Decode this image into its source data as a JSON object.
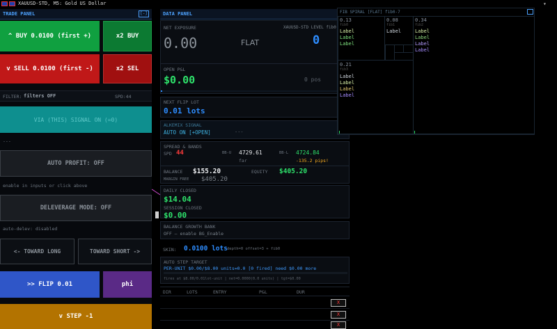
{
  "window": {
    "title": "XAUUSD-STD, M5:  Gold US Dollar"
  },
  "trade_panel": {
    "header": "TRADE PANEL",
    "header_btn": "[-]",
    "buy_label": "^ BUY  0.0100 (first +)",
    "x2_buy_label": "x2 BUY",
    "sell_label": "v SELL 0.0100 (first -)",
    "x2_sell_label": "x2 SEL",
    "filter_prefix": "FILTER:",
    "filter_value": "filters OFF",
    "spd": "SPD:44",
    "signal_label": "VIA (THIS) SIGNAL ON (=0)",
    "dash_line": "---",
    "auto_profit_label": "AUTO PROFIT: OFF",
    "auto_profit_hint": "enable in inputs or click above",
    "deleverage_label": "DELEVERAGE MODE: OFF",
    "deleverage_hint": "auto-delev: disabled",
    "toward_long_label": "<- TOWARD LONG",
    "toward_short_label": "TOWARD SHORT ->",
    "flip_label": ">> FLIP  0.01",
    "phi_label": "phi",
    "step_label": "v  STEP -1"
  },
  "data_panel": {
    "header": "DATA PANEL",
    "net_exposure_label": "NET EXPOSURE",
    "net_exposure_value": "0.00",
    "flat_label": "FLAT",
    "side_note": "XAUUSD-STD LEVEL fib0",
    "levels_value": "0",
    "open_pl_label": "OPEN P&L",
    "open_pl_value": "$0.00",
    "pos_count": "0 pos",
    "next_flip_label": "NEXT FLIP LOT",
    "next_flip_value": "0.01 lots",
    "alkemix_label": "ALKEMIX SIGNAL",
    "alkemix_value": "AUTO ON [+OPEN]",
    "alkemix_extra": "---",
    "spread_label": "SPREAD & BANDS",
    "spd_label": "SPD",
    "spd_value": "44",
    "bb_u_label": "BB-U",
    "bb_u_value": "4729.61",
    "bb_l_label": "BB-L",
    "bb_l_value": "4724.84",
    "far_label": "far",
    "pips_value": "-135.2 pips!",
    "balance_label": "BALANCE",
    "balance_value": "$155.20",
    "equity_label": "EQUITY",
    "equity_value": "$405.20",
    "margin_free_label": "MARGIN FREE",
    "margin_free_value": "$405.20",
    "daily_closed_label": "DAILY CLOSED",
    "daily_closed_value": "$14.04",
    "session_closed_label": "SESSION CLOSED",
    "session_closed_value": "$0.00",
    "growth_bank_label": "BALANCE GROWTH BANK",
    "growth_bank_value": "OFF — enable BG_Enable",
    "skin_label": "SKIN:",
    "skin_value": "0.0100 lots",
    "skin_extra": "depth=0  offset=3 + fib0",
    "auto_step_label": "AUTO STEP TARGET",
    "auto_step_value": "PER-UNIT $0.00/$8.00  units=0.0  [0 fired]  need $0.00 more",
    "auto_step_sub": "fires at $8.00/0.01lot-unit | net=0.0000(0.0 units) | tgt=$0.00",
    "table_headers": [
      "DIR",
      "LOTS",
      "ENTRY",
      "P&L",
      "DUR"
    ],
    "row_close_label": "X"
  },
  "fib_panel": {
    "header": "FIB SPIRAL  [FLAT]  fib0-7",
    "cells": [
      {
        "ratio": "0.13",
        "sub": "fib0",
        "labels": [
          "Label",
          "Label",
          "Label"
        ]
      },
      {
        "ratio": "0.08",
        "sub": "fib1",
        "labels": [
          "Label"
        ]
      },
      {
        "ratio": "0.34",
        "sub": "fib2",
        "labels": [
          "Label",
          "Label",
          "Label",
          "Label"
        ]
      },
      {
        "ratio": "0.21",
        "sub": "fib3",
        "labels": [
          "Label",
          "Label",
          "Label",
          "Label"
        ]
      }
    ]
  },
  "colors": {
    "buy": "#10a040",
    "sell": "#c01818",
    "signal": "#0e8f8f",
    "flip": "#2f56c8",
    "phi": "#5a2a86",
    "step": "#b37300",
    "accent_blue": "#2e8dff",
    "profit_green": "#2ee26b"
  }
}
